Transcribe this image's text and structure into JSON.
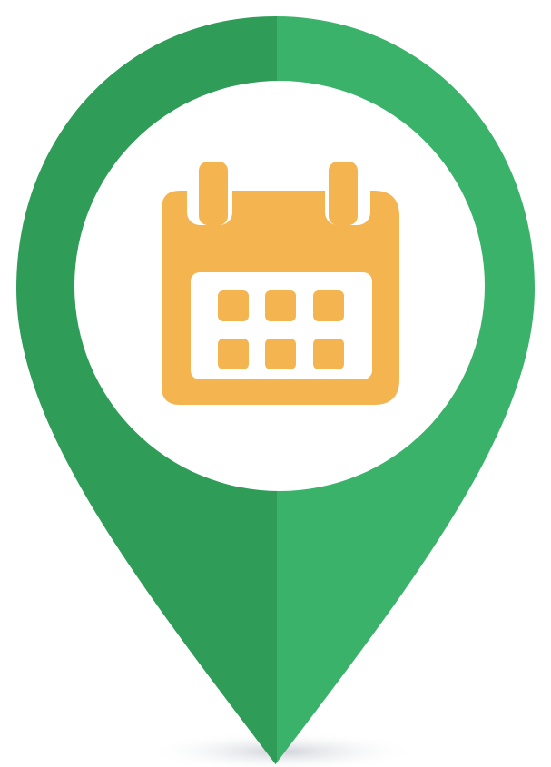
{
  "icon": {
    "name": "map-pin-calendar-icon",
    "inner_icon": "calendar-icon"
  },
  "colors": {
    "pin_left": "#2f9d57",
    "pin_right": "#3bb26a",
    "inner_circle": "#ffffff",
    "calendar": "#f4b450",
    "shadow": "#d9dce2"
  }
}
